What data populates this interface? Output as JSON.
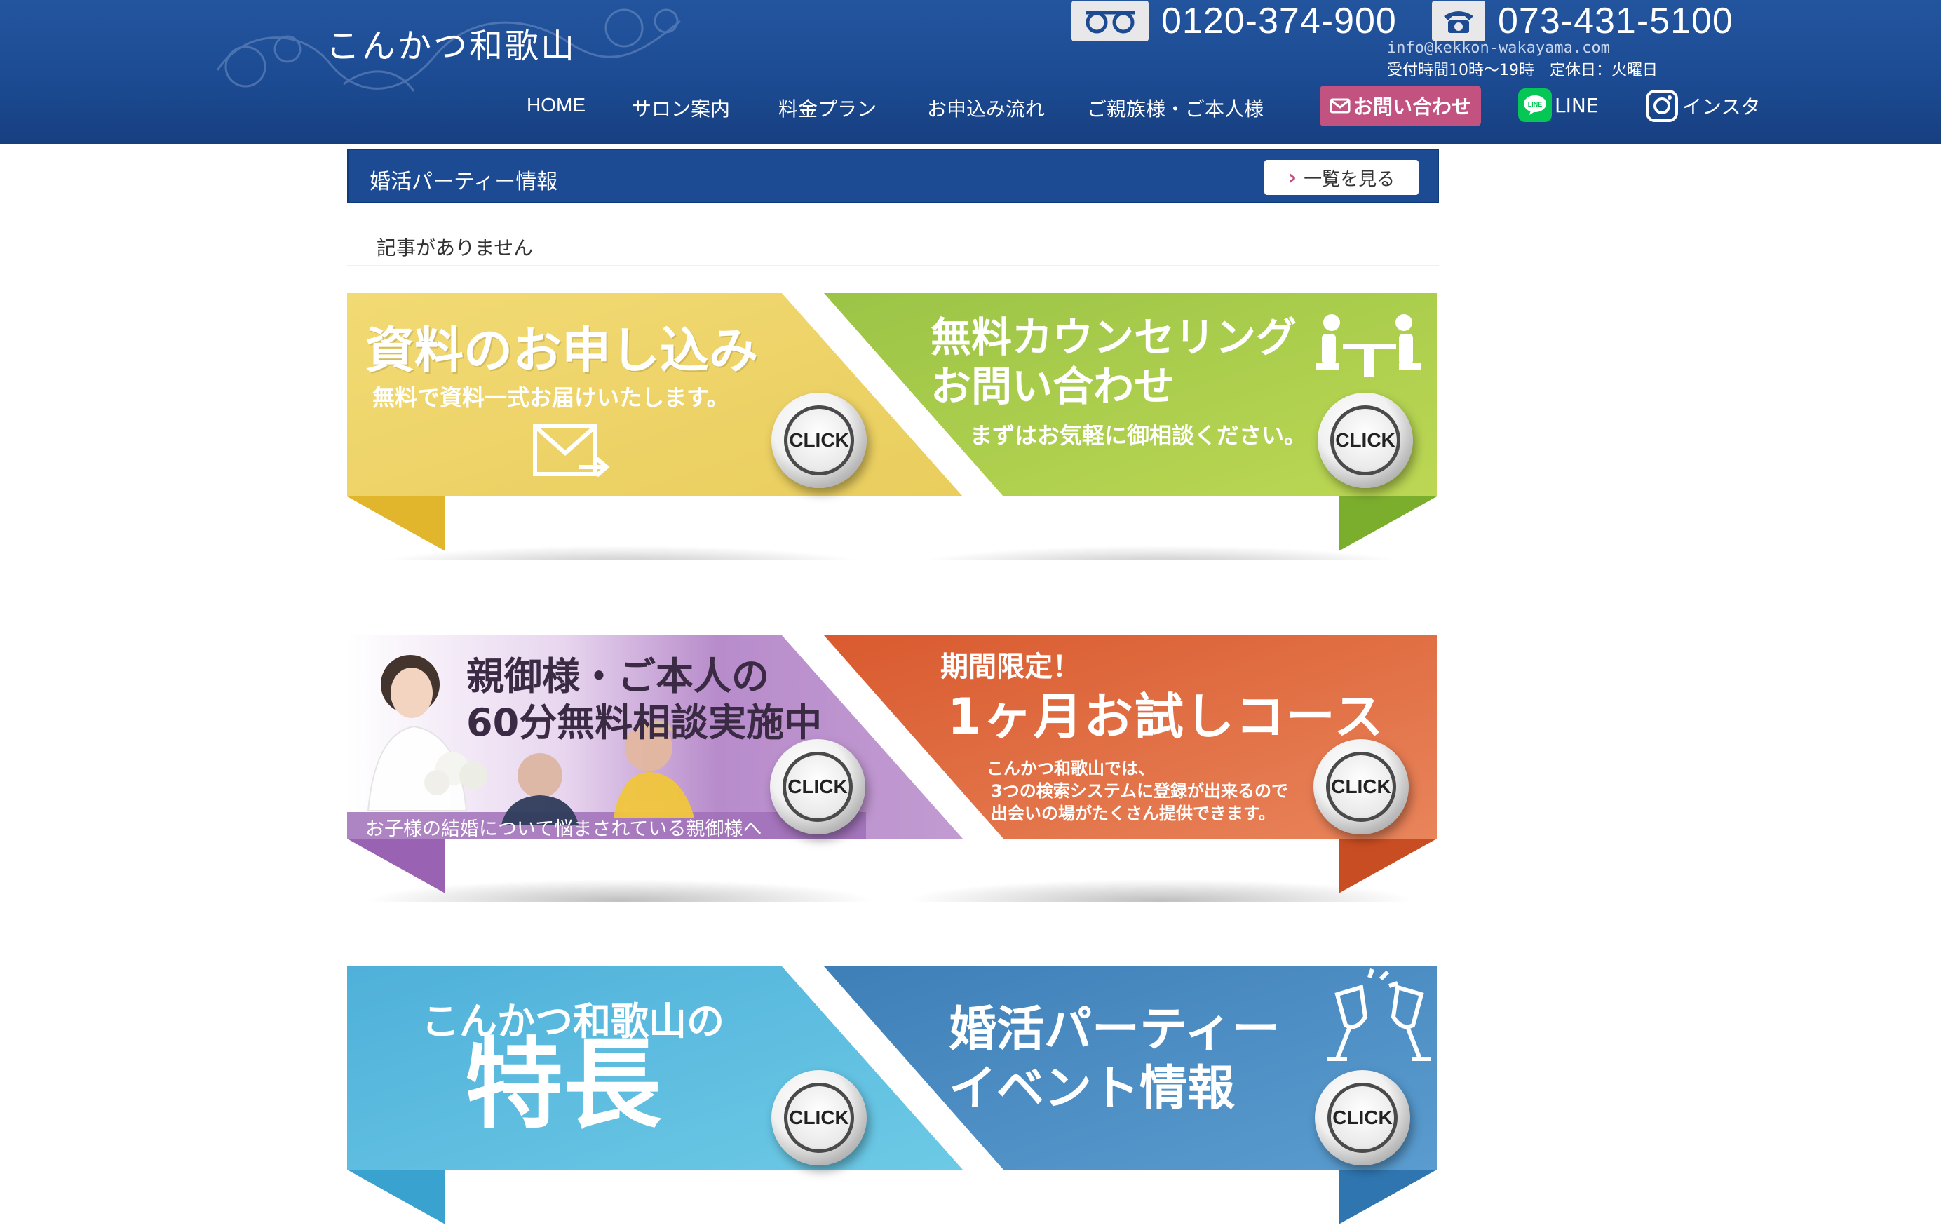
{
  "header": {
    "logo_text": "こんかつ和歌山",
    "free_dial_number": "0120-374-900",
    "tel_number": "073-431-5100",
    "email": "info@kekkon-wakayama.com",
    "hours": "受付時間10時～19時　定休日：火曜日",
    "nav": {
      "home": "HOME",
      "salon": "サロン案内",
      "pricing": "料金プラン",
      "flow": "お申込み流れ",
      "family": "ご親族様・ご本人様",
      "contact": "お問い合わせ",
      "line": "LINE",
      "instagram": "インスタ"
    }
  },
  "party_panel": {
    "title": "婚活パーティー情報",
    "list_button": "一覧を見る",
    "empty_message": "記事がありません"
  },
  "banners": {
    "click_label": "CLICK",
    "brochure": {
      "title": "資料のお申し込み",
      "subtitle": "無料で資料一式お届けいたします。",
      "color": "#eed66f"
    },
    "counseling": {
      "title_line1": "無料カウンセリング",
      "title_line2": "お問い合わせ",
      "subtitle": "まずはお気軽に御相談ください。",
      "color": "#a5c94a"
    },
    "parents": {
      "title_line1": "親御様・ご本人の",
      "title_line2": "60分無料相談実施中",
      "caption": "お子様の結婚について悩まされている親御様へ",
      "color": "#b58bc9"
    },
    "trial": {
      "label": "期間限定！",
      "title": "1ヶ月お試しコース",
      "desc_line1": "こんかつ和歌山では、",
      "desc_line2": "3つの検索システムに登録が出来るので",
      "desc_line3": "出会いの場がたくさん提供できます。",
      "color": "#e0683d"
    },
    "features": {
      "title_line1": "こんかつ和歌山の",
      "title_line2": "特長",
      "color": "#5bbde0"
    },
    "events": {
      "title_line1": "婚活パーティー",
      "title_line2": "イベント情報",
      "color": "#4a8fc5"
    }
  }
}
